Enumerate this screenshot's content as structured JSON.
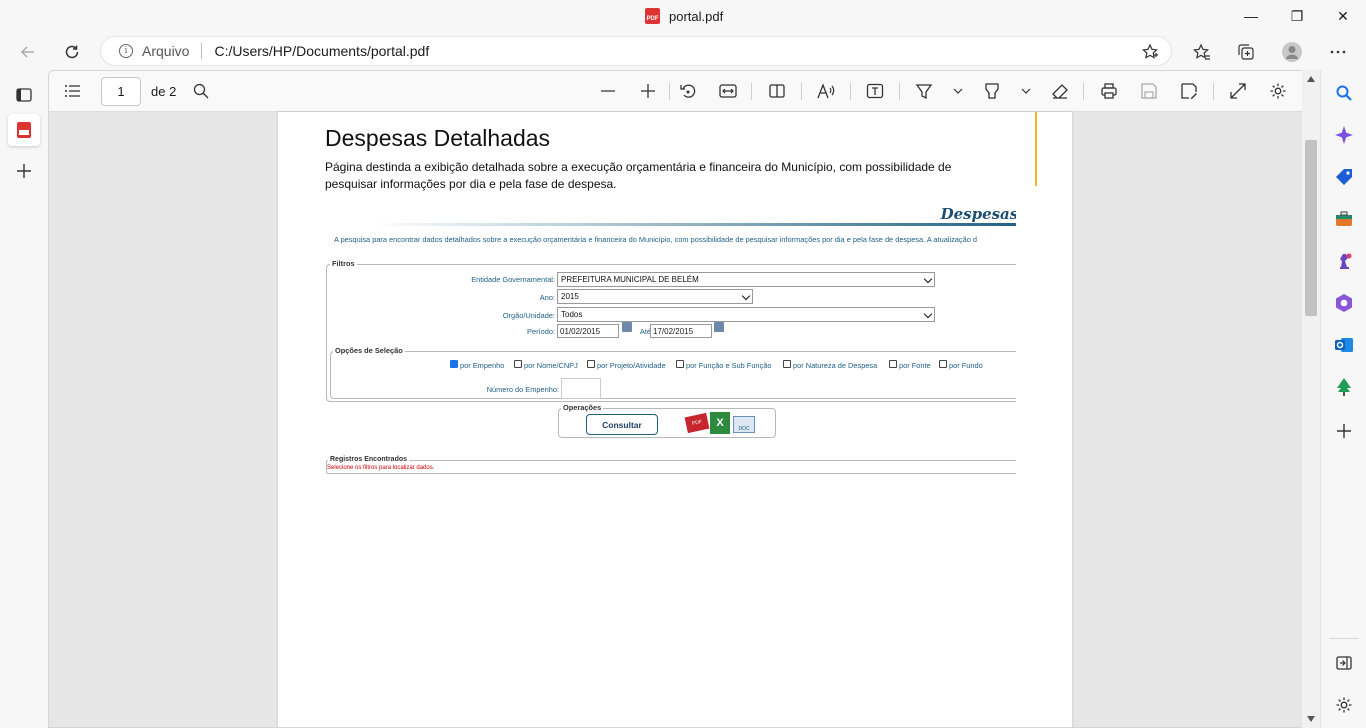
{
  "window": {
    "tab_title": "portal.pdf",
    "pdf_badge": "PDF",
    "minimize": "—",
    "restore": "❐",
    "close": "✕"
  },
  "address": {
    "info_glyph": "i",
    "scheme_label": "Arquivo",
    "path": "C:/Users/HP/Documents/portal.pdf"
  },
  "pdf_toolbar": {
    "current_page": "1",
    "page_of": "de 2"
  },
  "document": {
    "title": "Despesas Detalhadas",
    "description": "Página destinda a exibição detalhada sobre a execução orçamentária e financeira do Município, com possibilidade de pesquisar informações por dia e pela fase de despesa.",
    "screenshot": {
      "header_title": "Despesas De",
      "intro": "A pesquisa para encontrar dados detalhados sobre a execução orçamentária e financeira do Município, com possibilidade de pesquisar informações por dia e pela fase de despesa. A atualização d",
      "filtros_legend": "Filtros",
      "entidade_label": "Entidade Governamental:",
      "entidade_value": "PREFEITURA MUNICIPAL DE BELÉM",
      "ano_label": "Ano:",
      "ano_value": "2015",
      "orgao_label": "Orgão/Unidade:",
      "orgao_value": "Todos",
      "periodo_label": "Período:",
      "periodo_from": "01/02/2015",
      "ate_label": "Até",
      "periodo_to": "17/02/2015",
      "opcoes_legend": "Opções de Seleção",
      "options": [
        {
          "label": "por Empenho",
          "checked": true
        },
        {
          "label": "por Nome/CNPJ",
          "checked": false
        },
        {
          "label": "por Projeto/Atividade",
          "checked": false
        },
        {
          "label": "por Função e Sub Função",
          "checked": false
        },
        {
          "label": "por Natureza de Despesa",
          "checked": false
        },
        {
          "label": "por Fonte",
          "checked": false
        },
        {
          "label": "por Fundo",
          "checked": false
        }
      ],
      "numero_empenho_label": "Número do Empenho:",
      "operacoes_legend": "Operações",
      "consultar_button": "Consultar",
      "pdf_icon_label": "PDF",
      "xls_icon_label": "X",
      "doc_icon_label": "DOC",
      "registros_legend": "Registros Encontrados",
      "registros_message": "Selecione os filtros para localizar dados."
    }
  },
  "colors": {
    "pdf_red": "#dd3333",
    "link_blue": "#1e5f86",
    "accent_yellow": "#f4b81c"
  }
}
